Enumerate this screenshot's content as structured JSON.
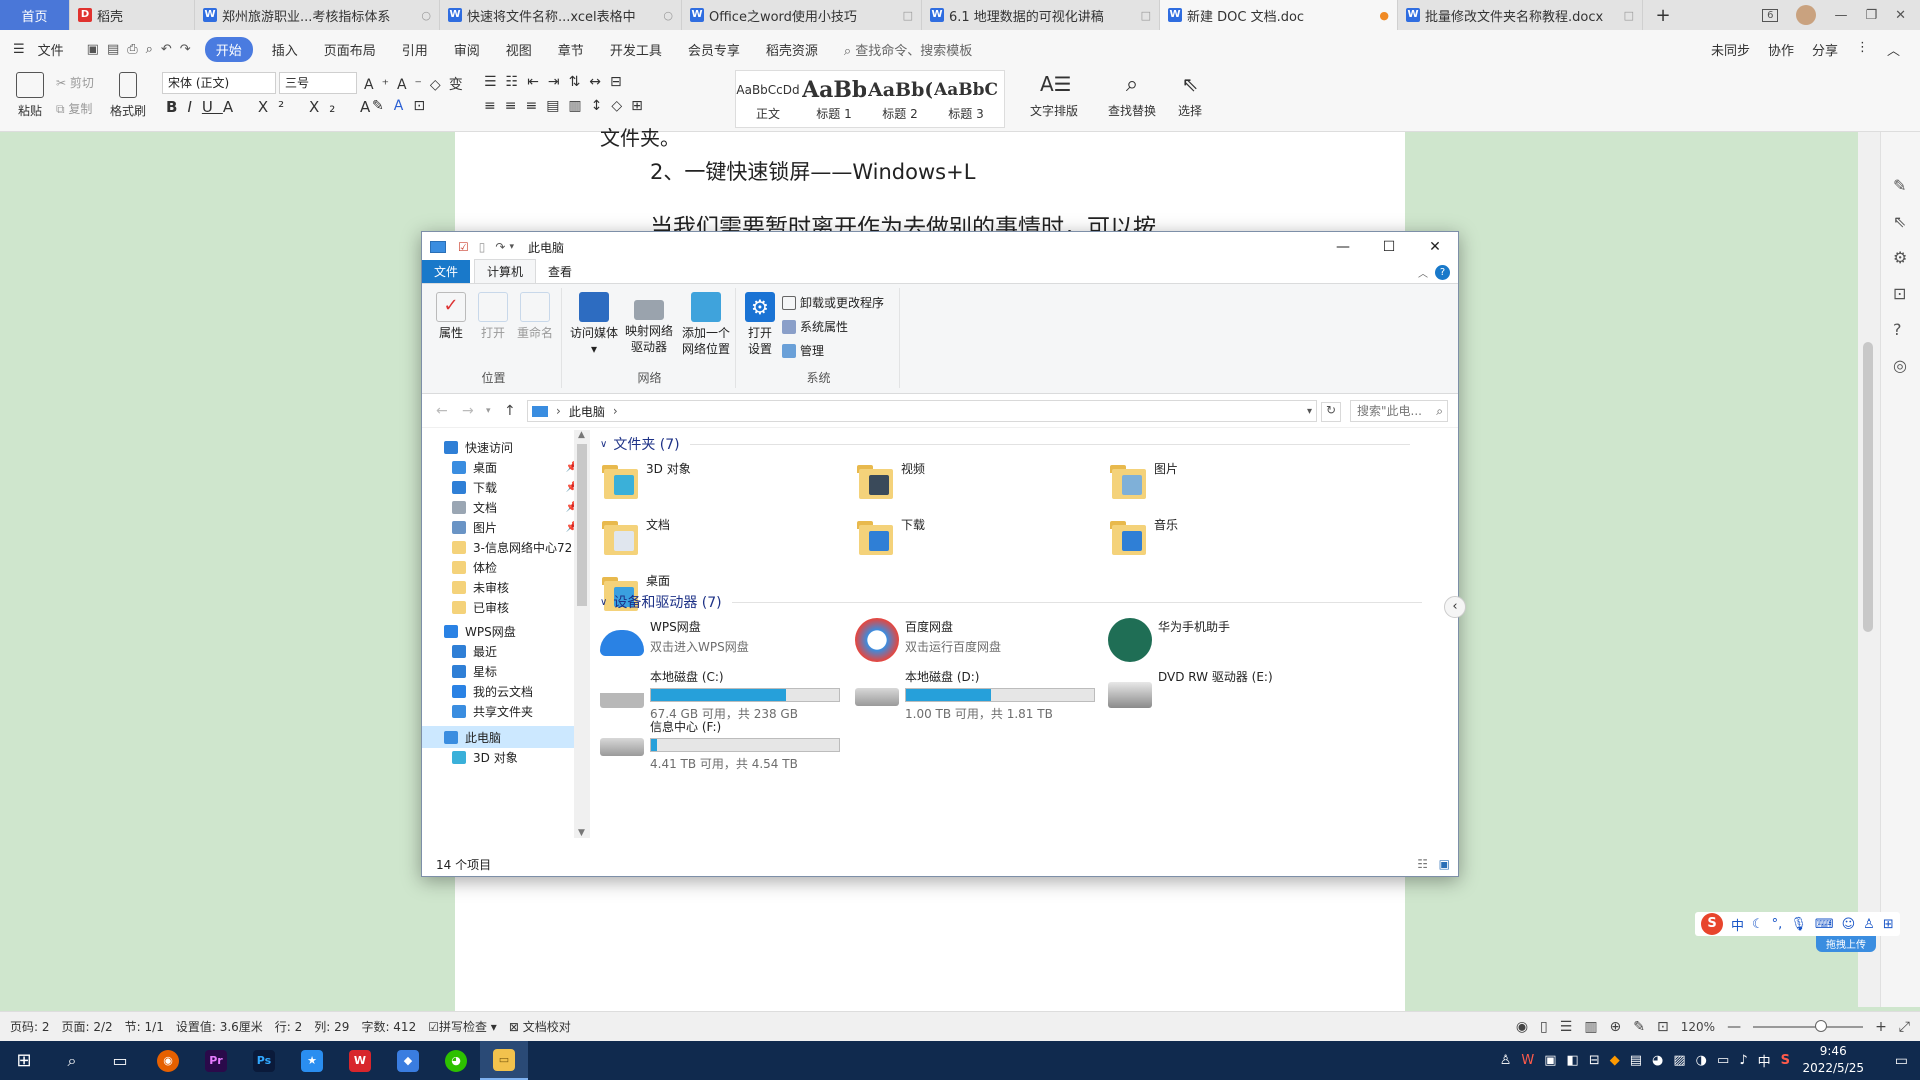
{
  "tabs": [
    {
      "label": "首页",
      "type": "home"
    },
    {
      "label": "稻壳",
      "type": "docer"
    },
    {
      "label": "郑州旅游职业...考核指标体系",
      "type": "doc"
    },
    {
      "label": "快速将文件名称...xcel表格中",
      "type": "doc"
    },
    {
      "label": "Office之word使用小技巧",
      "type": "doc"
    },
    {
      "label": "6.1 地理数据的可视化讲稿",
      "type": "doc"
    },
    {
      "label": "新建 DOC 文档.doc",
      "type": "doc-active"
    },
    {
      "label": "批量修改文件夹名称教程.docx",
      "type": "doc"
    }
  ],
  "tabbar_right": {
    "new_tab": "+",
    "badge": "6"
  },
  "menu": {
    "file": "文件",
    "items": [
      "开始",
      "插入",
      "页面布局",
      "引用",
      "审阅",
      "视图",
      "章节",
      "开发工具",
      "会员专享",
      "稻壳资源"
    ],
    "active": "开始",
    "search": "查找命令、搜索模板",
    "right": [
      "未同步",
      "协作",
      "分享"
    ]
  },
  "toolbar": {
    "paste": "粘贴",
    "cut": "剪切",
    "copy": "复制",
    "format_painter": "格式刷",
    "font_name": "宋体 (正文)",
    "font_size": "三号",
    "styles": [
      {
        "preview": "AaBbCcDd",
        "label": "正文"
      },
      {
        "preview": "AaBb",
        "label": "标题 1"
      },
      {
        "preview": "AaBb(",
        "label": "标题 2"
      },
      {
        "preview": "AaBbC(",
        "label": "标题 3"
      }
    ],
    "text_layout": "文字排版",
    "find_replace": "查找替换",
    "select": "选择"
  },
  "document": {
    "line_top": "文件夹。",
    "line1": "2、一键快速锁屏——Windows+L",
    "line2": "当我们需要暂时离开作为去做别的事情时，可以按"
  },
  "status": {
    "page_no": "页码: 2",
    "pages": "页面: 2/2",
    "section": "节: 1/1",
    "setting": "设置值: 3.6厘米",
    "row": "行: 2",
    "col": "列: 29",
    "words": "字数: 412",
    "spell": "拼写检查",
    "proof": "文档校对",
    "zoom": "120%",
    "zoom_fraction": 0.62
  },
  "taskbar": {
    "time": "9:46",
    "date": "2022/5/25",
    "ime": "中"
  },
  "explorer": {
    "title": "此电脑",
    "ribbon_tabs": [
      "文件",
      "计算机",
      "查看"
    ],
    "groups": [
      {
        "label": "位置",
        "buttons": [
          "属性",
          "打开",
          "重命名"
        ]
      },
      {
        "label": "网络",
        "buttons": [
          "访问媒体",
          "映射网络\n驱动器",
          "添加一个\n网络位置"
        ]
      },
      {
        "label": "系统",
        "buttons": [
          "打开\n设置"
        ],
        "small": [
          "卸载或更改程序",
          "系统属性",
          "管理"
        ]
      }
    ],
    "address": "此电脑",
    "search_placeholder": "搜索\"此电...",
    "nav": [
      {
        "label": "快速访问",
        "icon": "star-icon",
        "level": 0
      },
      {
        "label": "桌面",
        "icon": "desktop-icon",
        "level": 1,
        "pinned": true
      },
      {
        "label": "下载",
        "icon": "download-icon",
        "level": 1,
        "pinned": true
      },
      {
        "label": "文档",
        "icon": "document-icon",
        "level": 1,
        "pinned": true
      },
      {
        "label": "图片",
        "icon": "picture-icon",
        "level": 1,
        "pinned": true
      },
      {
        "label": "3-信息网络中心72",
        "icon": "folder-icon",
        "level": 1
      },
      {
        "label": "体检",
        "icon": "folder-icon",
        "level": 1
      },
      {
        "label": "未审核",
        "icon": "folder-icon",
        "level": 1
      },
      {
        "label": "已审核",
        "icon": "folder-icon",
        "level": 1
      },
      {
        "label": "WPS网盘",
        "icon": "cloud-icon",
        "level": 0
      },
      {
        "label": "最近",
        "icon": "clock-icon",
        "level": 1
      },
      {
        "label": "星标",
        "icon": "star-icon",
        "level": 1
      },
      {
        "label": "我的云文档",
        "icon": "cloud-icon",
        "level": 1
      },
      {
        "label": "共享文件夹",
        "icon": "share-icon",
        "level": 1
      },
      {
        "label": "此电脑",
        "icon": "computer-icon",
        "level": 0,
        "selected": true
      },
      {
        "label": "3D 对象",
        "icon": "cube-icon",
        "level": 1
      }
    ],
    "folders_header": "文件夹 (7)",
    "folders": [
      {
        "label": "3D 对象",
        "overlay": "cube"
      },
      {
        "label": "视频",
        "overlay": "film"
      },
      {
        "label": "图片",
        "overlay": "picture"
      },
      {
        "label": "文档",
        "overlay": "document"
      },
      {
        "label": "下载",
        "overlay": "download"
      },
      {
        "label": "音乐",
        "overlay": "music"
      },
      {
        "label": "桌面",
        "overlay": "desktop"
      }
    ],
    "devices_header": "设备和驱动器 (7)",
    "devices": [
      {
        "label": "WPS网盘",
        "sub": "双击进入WPS网盘",
        "icon": "wps-cloud-icon"
      },
      {
        "label": "百度网盘",
        "sub": "双击运行百度网盘",
        "icon": "baidu-cloud-icon"
      },
      {
        "label": "华为手机助手",
        "sub": "",
        "icon": "huawei-icon"
      },
      {
        "label": "本地磁盘 (C:)",
        "sub": "67.4 GB 可用，共 238 GB",
        "icon": "windows-drive-icon",
        "used_fraction": 0.72
      },
      {
        "label": "本地磁盘 (D:)",
        "sub": "1.00 TB 可用，共 1.81 TB",
        "icon": "drive-icon",
        "used_fraction": 0.45
      },
      {
        "label": "DVD RW 驱动器 (E:)",
        "sub": "",
        "icon": "dvd-icon"
      },
      {
        "label": "信息中心 (F:)",
        "sub": "4.41 TB 可用，共 4.54 TB",
        "icon": "drive-icon",
        "used_fraction": 0.03
      }
    ],
    "item_count": "14 个项目"
  },
  "ime_toolbar": {
    "label": "中",
    "upload": "拖拽上传"
  },
  "colors": {
    "accent": "#4a7be0",
    "explorer_file_tab": "#1979ca",
    "drive_fill": "#26a0da",
    "doc_bg": "#cfe6cd",
    "taskbar": "#102a4e"
  }
}
